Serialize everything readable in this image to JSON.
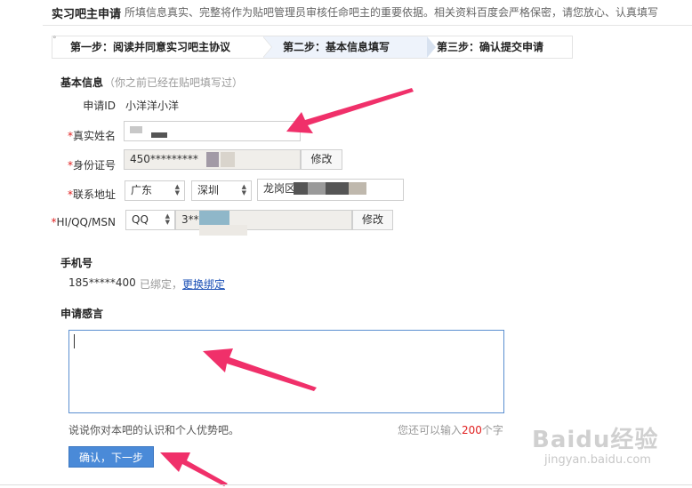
{
  "header": {
    "title": "实习吧主申请",
    "description": "所填信息真实、完整将作为贴吧管理员审核任命吧主的重要依据。相关资料百度会严格保密，请您放心、认真填写"
  },
  "steps": [
    {
      "label": "第一步：阅读并同意实习吧主协议"
    },
    {
      "label": "第二步：基本信息填写"
    },
    {
      "label": "第三步：确认提交申请"
    }
  ],
  "basic_info": {
    "title": "基本信息",
    "hint": "（你之前已经在贴吧填写过）",
    "apply_id_label": "申请ID",
    "apply_id_value": "小洋洋小洋",
    "real_name_label": "真实姓名",
    "real_name_value": "",
    "id_card_label": "身份证号",
    "id_card_value": "450*********",
    "id_card_modify": "修改",
    "address_label": "联系地址",
    "province": "广东",
    "city": "深圳",
    "address_detail": "龙岗区",
    "im_label": "HI/QQ/MSN",
    "im_type": "QQ",
    "im_value": "3***",
    "im_modify": "修改",
    "required_mark": "*"
  },
  "phone": {
    "title": "手机号",
    "number": "185*****400",
    "bound_text": "已绑定，",
    "change_link": "更换绑定"
  },
  "statement": {
    "title": "申请感言",
    "value": "",
    "tip": "说说你对本吧的认识和个人优势吧。",
    "counter_prefix": "您还可以输入",
    "counter_num": "200",
    "counter_suffix": "个字"
  },
  "submit_label": "确认，下一步",
  "watermark": {
    "brand": "Baidu经验",
    "url": "jingyan.baidu.com"
  },
  "colors": {
    "accent": "#4a8ad8",
    "required": "#e02020",
    "link": "#1a4fb5",
    "arrow": "#f0306a"
  }
}
